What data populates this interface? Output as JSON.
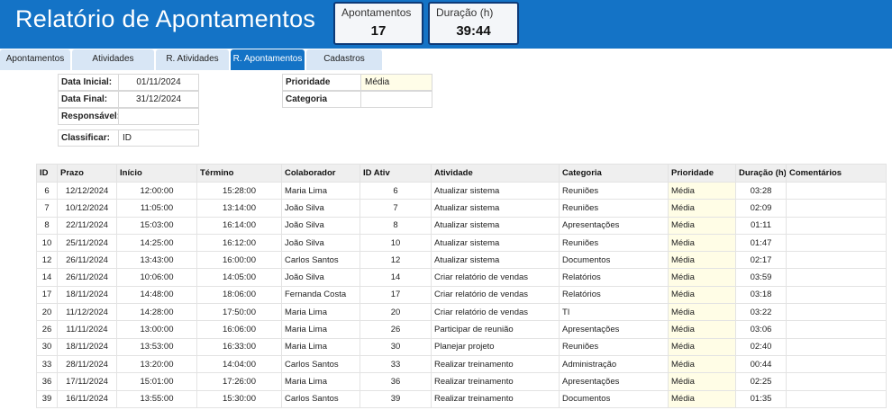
{
  "header": {
    "title": "Relatório de Apontamentos",
    "kpis": [
      {
        "label": "Apontamentos",
        "value": "17"
      },
      {
        "label": "Duração (h)",
        "value": "39:44"
      }
    ]
  },
  "tabs": [
    {
      "label": "Apontamentos"
    },
    {
      "label": "Atividades"
    },
    {
      "label": "R. Atividades"
    },
    {
      "label": "R. Apontamentos"
    },
    {
      "label": "Cadastros"
    }
  ],
  "filters": {
    "data_inicial": {
      "label": "Data Inicial:",
      "value": "01/11/2024"
    },
    "data_final": {
      "label": "Data Final:",
      "value": "31/12/2024"
    },
    "responsavel": {
      "label": "Responsável:",
      "value": ""
    },
    "classificar": {
      "label": "Classificar:",
      "value": "ID"
    },
    "prioridade": {
      "label": "Prioridade",
      "value": "Média"
    },
    "categoria": {
      "label": "Categoria",
      "value": ""
    }
  },
  "table": {
    "columns": [
      "ID",
      "Prazo",
      "Início",
      "Término",
      "Colaborador",
      "ID Ativ",
      "Atividade",
      "Categoria",
      "Prioridade",
      "Duração (h)",
      "Comentários"
    ],
    "rows": [
      [
        "6",
        "12/12/2024",
        "12:00:00",
        "15:28:00",
        "Maria Lima",
        "6",
        "Atualizar sistema",
        "Reuniões",
        "Média",
        "03:28",
        ""
      ],
      [
        "7",
        "10/12/2024",
        "11:05:00",
        "13:14:00",
        "João Silva",
        "7",
        "Atualizar sistema",
        "Reuniões",
        "Média",
        "02:09",
        ""
      ],
      [
        "8",
        "22/11/2024",
        "15:03:00",
        "16:14:00",
        "João Silva",
        "8",
        "Atualizar sistema",
        "Apresentações",
        "Média",
        "01:11",
        ""
      ],
      [
        "10",
        "25/11/2024",
        "14:25:00",
        "16:12:00",
        "João Silva",
        "10",
        "Atualizar sistema",
        "Reuniões",
        "Média",
        "01:47",
        ""
      ],
      [
        "12",
        "26/11/2024",
        "13:43:00",
        "16:00:00",
        "Carlos Santos",
        "12",
        "Atualizar sistema",
        "Documentos",
        "Média",
        "02:17",
        ""
      ],
      [
        "14",
        "26/11/2024",
        "10:06:00",
        "14:05:00",
        "João Silva",
        "14",
        "Criar relatório de vendas",
        "Relatórios",
        "Média",
        "03:59",
        ""
      ],
      [
        "17",
        "18/11/2024",
        "14:48:00",
        "18:06:00",
        "Fernanda Costa",
        "17",
        "Criar relatório de vendas",
        "Relatórios",
        "Média",
        "03:18",
        ""
      ],
      [
        "20",
        "11/12/2024",
        "14:28:00",
        "17:50:00",
        "Maria Lima",
        "20",
        "Criar relatório de vendas",
        "TI",
        "Média",
        "03:22",
        ""
      ],
      [
        "26",
        "11/11/2024",
        "13:00:00",
        "16:06:00",
        "Maria Lima",
        "26",
        "Participar de reunião",
        "Apresentações",
        "Média",
        "03:06",
        ""
      ],
      [
        "30",
        "18/11/2024",
        "13:53:00",
        "16:33:00",
        "Maria Lima",
        "30",
        "Planejar projeto",
        "Reuniões",
        "Média",
        "02:40",
        ""
      ],
      [
        "33",
        "28/11/2024",
        "13:20:00",
        "14:04:00",
        "Carlos Santos",
        "33",
        "Realizar treinamento",
        "Administração",
        "Média",
        "00:44",
        ""
      ],
      [
        "36",
        "17/11/2024",
        "15:01:00",
        "17:26:00",
        "Maria Lima",
        "36",
        "Realizar treinamento",
        "Apresentações",
        "Média",
        "02:25",
        ""
      ],
      [
        "39",
        "16/11/2024",
        "13:55:00",
        "15:30:00",
        "Carlos Santos",
        "39",
        "Realizar treinamento",
        "Documentos",
        "Média",
        "01:35",
        ""
      ]
    ]
  }
}
